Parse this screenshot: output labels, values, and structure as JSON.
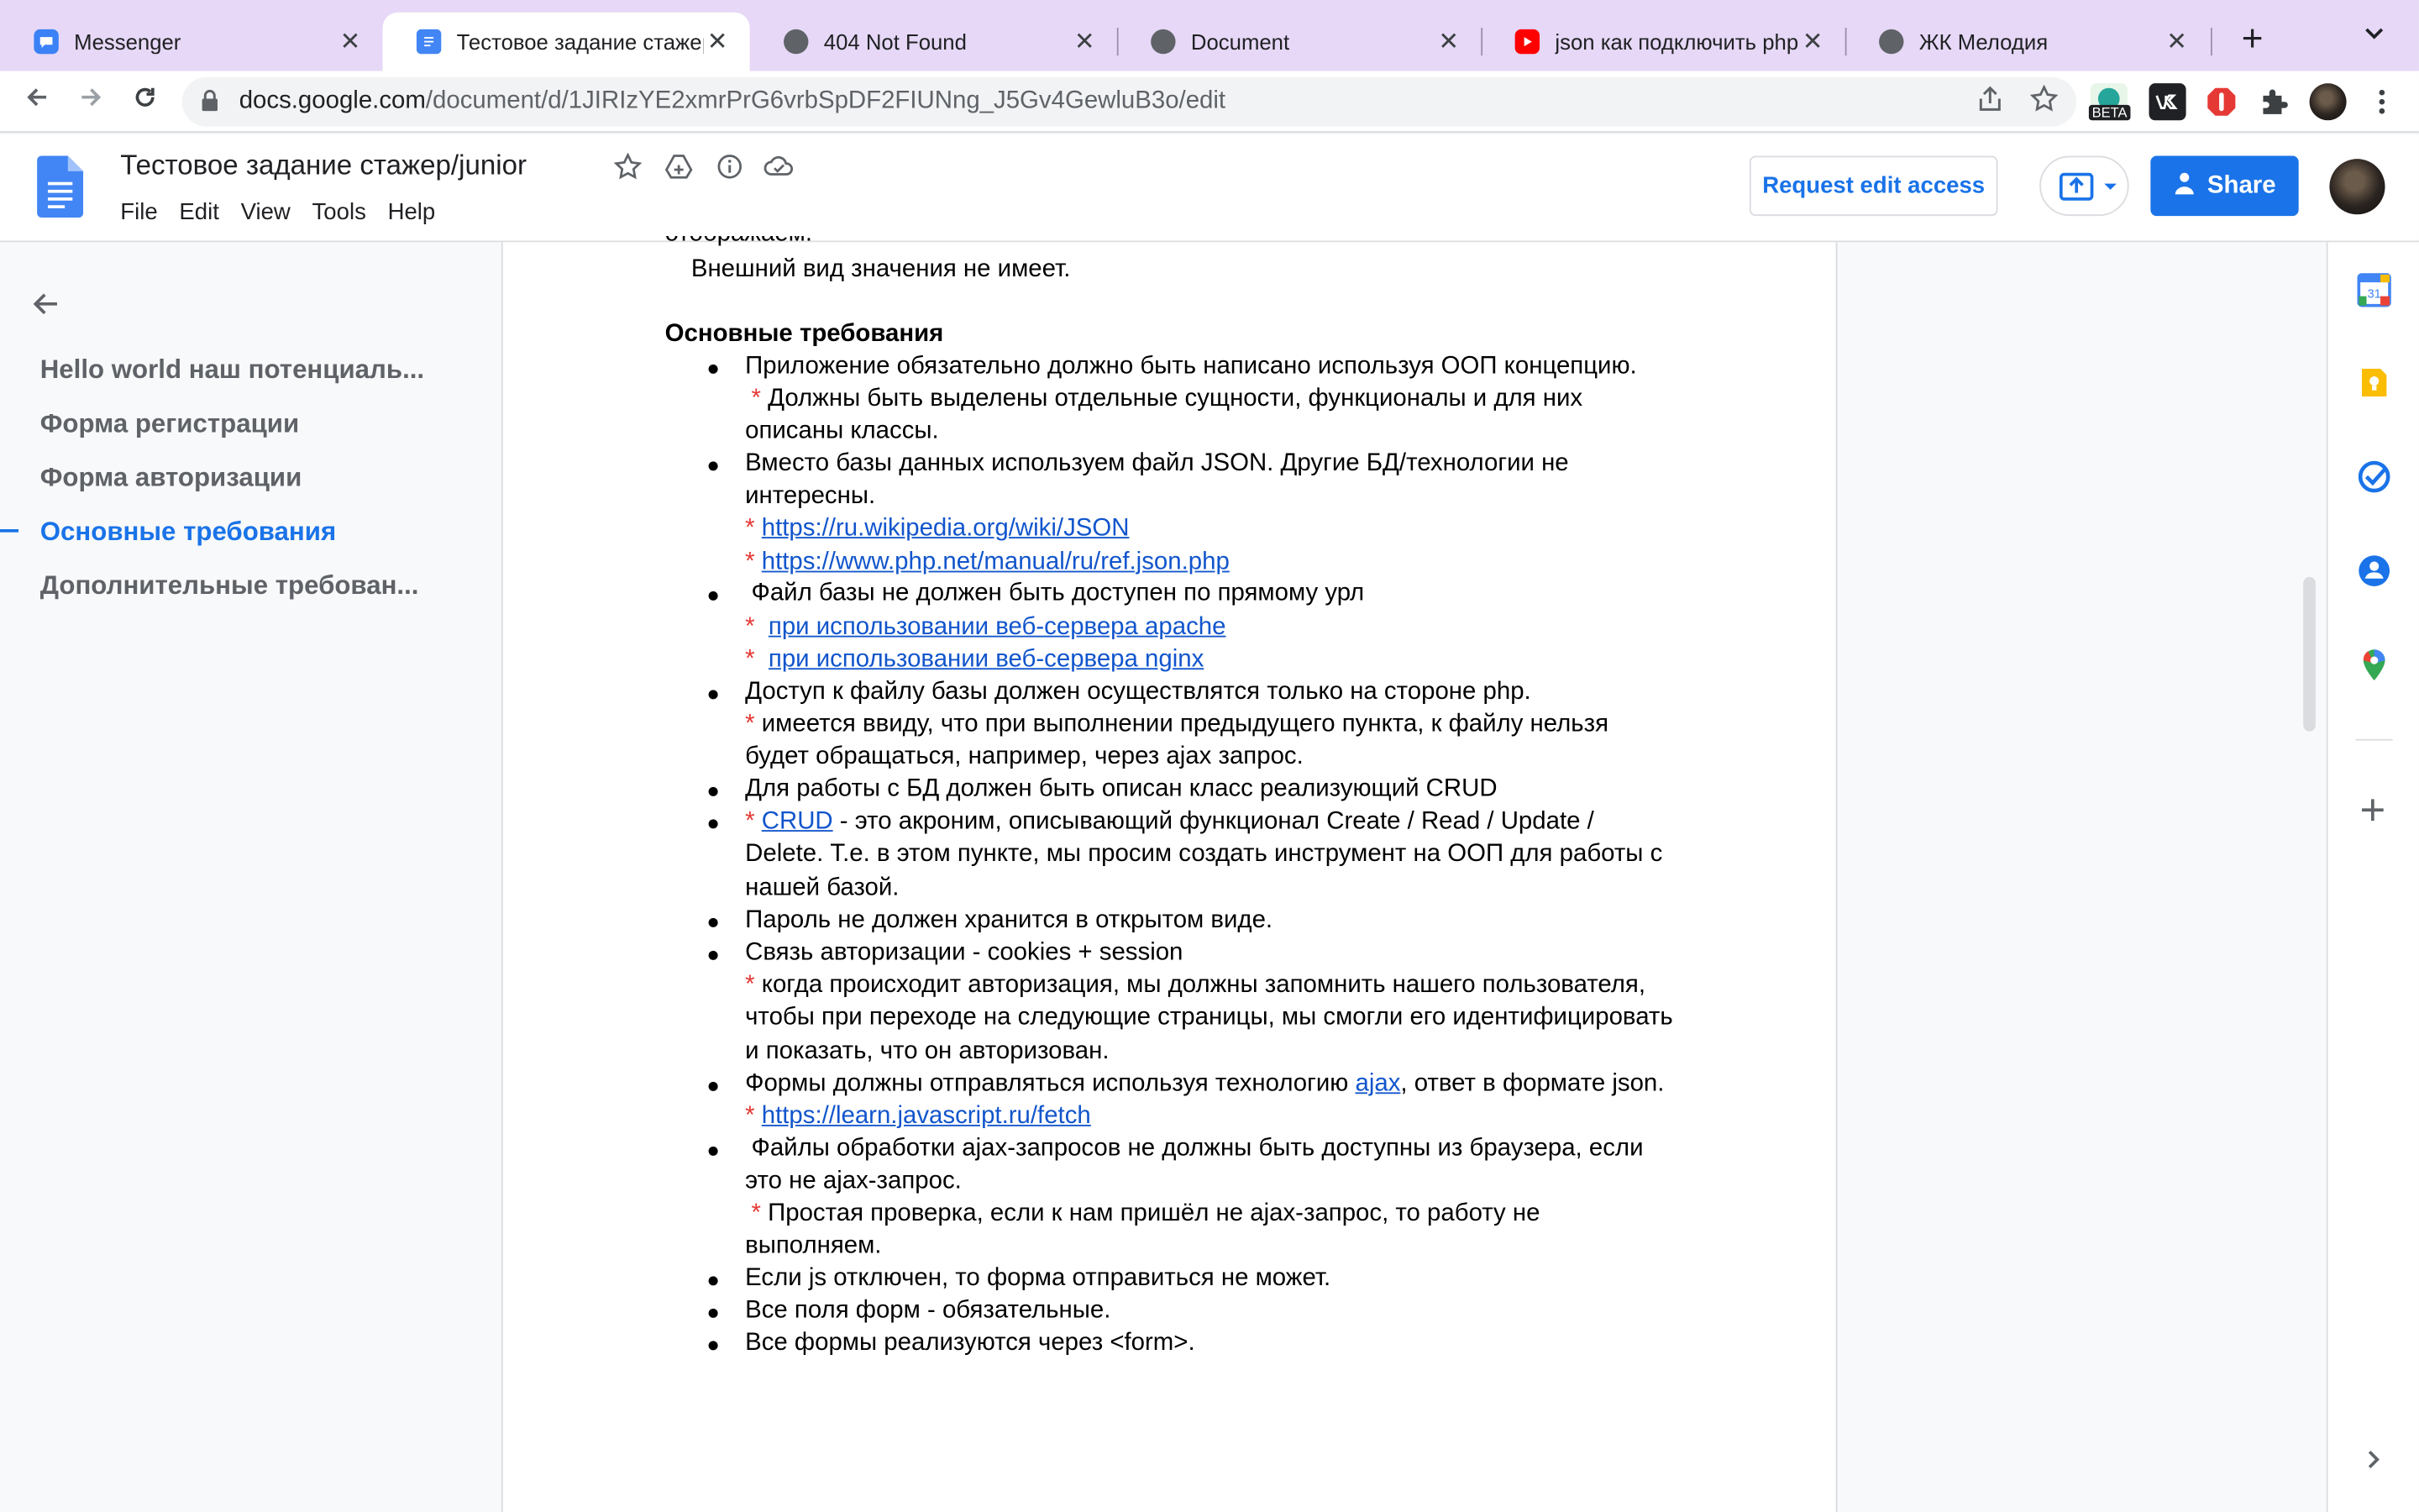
{
  "browser": {
    "tabs": [
      {
        "title": "Messenger",
        "active": false
      },
      {
        "title": "Тестовое задание стажер/junior",
        "active": true
      },
      {
        "title": "404 Not Found",
        "active": false
      },
      {
        "title": "Document",
        "active": false
      },
      {
        "title": "json как подключить php",
        "active": false
      },
      {
        "title": "ЖК Мелодия",
        "active": false
      }
    ],
    "new_tab": "+",
    "tab_list": "⌄",
    "url_host": "docs.google.com",
    "url_path": "/document/d/1JIRIzYE2xmrPrG6vrbSpDF2FIUNng_J5Gv4GewluB3o/edit",
    "beta_badge": "BETA"
  },
  "docs": {
    "title": "Тестовое задание стажер/junior",
    "menu": [
      "File",
      "Edit",
      "View",
      "Tools",
      "Help"
    ],
    "request_edit": "Request edit access",
    "share": "Share"
  },
  "outline": {
    "items": [
      {
        "label": "Hello world наш потенциаль...",
        "active": false
      },
      {
        "label": "Форма регистрации",
        "active": false
      },
      {
        "label": "Форма авторизации",
        "active": false
      },
      {
        "label": "Основные требования",
        "active": true
      },
      {
        "label": "Дополнительные требован...",
        "active": false
      }
    ]
  },
  "document": {
    "top_cut": "отображаем.",
    "intro_line": "Внешний вид значения не имеет.",
    "heading": "Основные требования",
    "l1": "Приложение обязательно должно быть написано используя ООП концепцию.",
    "l2": "Должны быть выделены отдельные сущности, функционалы и для них",
    "l3": "описаны классы.",
    "l4": "Вместо базы данных используем файл JSON. Другие БД/технологии не",
    "l5": "интересны.",
    "link1": "https://ru.wikipedia.org/wiki/JSON",
    "link2": "https://www.php.net/manual/ru/ref.json.php",
    "l8": "Файл базы не должен быть доступен по прямому урл",
    "link3": "при использовании веб-сервера apache",
    "link4": "при использовании веб-сервера nginx",
    "l11": "Доступ к файлу базы должен осуществлятся только на стороне php.",
    "l12": "имеется ввиду, что при выполнении предыдущего пункта, к файлу нельзя",
    "l13": "будет обращаться, например, через ajax запрос.",
    "l14": "Для работы с БД должен быть описан класс реализующий CRUD",
    "crud_link": "CRUD",
    "l15": " - это акроним, описывающий функционал Create / Read / Update /",
    "l16": "Delete. Т.е. в этом пункте, мы просим создать инструмент на ООП для работы с",
    "l17": "нашей базой.",
    "l18": "Пароль не должен хранится в открытом виде.",
    "l19": "Связь авторизации  - cookies + session",
    "l20": "когда происходит авторизация, мы должны запомнить нашего пользователя,",
    "l21": "чтобы при переходе на следующие страницы, мы смогли его идентифицировать",
    "l22": "и показать, что он авторизован.",
    "l23a": "Формы должны отправляться используя технологию ",
    "ajax_link": "ajax",
    "l23b": ", ответ в формате json.",
    "link5": "https://learn.javascript.ru/fetch",
    "l25": "Файлы обработки ajax-запросов не должны быть доступны из браузера, если",
    "l26": "это не ajax-запрос.",
    "l27": "Простая проверка, если к нам пришёл не ajax-запрос, то работу не",
    "l28": "выполняем.",
    "l29": "Если js отключен, то форма отправиться не может.",
    "l30": "Все поля форм - обязательные.",
    "l31": "Все формы реализуются через <form>.",
    "bullet": "●",
    "star": "*"
  },
  "colors": {
    "tabstrip": "#e6d8f6",
    "accent": "#1a73e8",
    "link": "#1155cc",
    "star": "#e53935"
  }
}
